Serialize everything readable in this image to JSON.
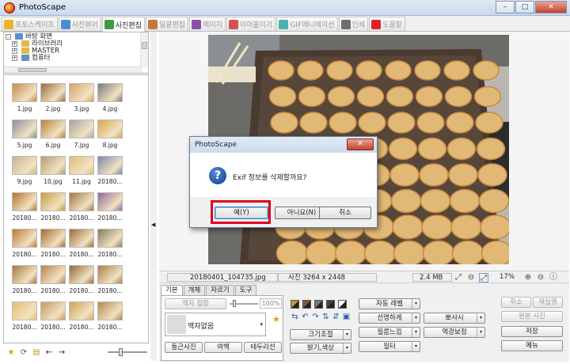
{
  "window": {
    "title": "PhotoScape",
    "minimize": "–",
    "maximize": "□",
    "close": "✕"
  },
  "tabs": [
    {
      "label": "포토스케이프",
      "color": "#e9b52d",
      "active": false
    },
    {
      "label": "사진뷰어",
      "color": "#4a8ed6",
      "active": false
    },
    {
      "label": "사진편집",
      "color": "#3b9a43",
      "active": true
    },
    {
      "label": "일괄편집",
      "color": "#c2783c",
      "active": false
    },
    {
      "label": "페이지",
      "color": "#8b4fa8",
      "active": false
    },
    {
      "label": "이어붙이기",
      "color": "#d94f4f",
      "active": false
    },
    {
      "label": "GIF애니메이션",
      "color": "#4ab0b0",
      "active": false
    },
    {
      "label": "인쇄",
      "color": "#6f6f6f",
      "active": false
    },
    {
      "label": "도움말",
      "color": "#d22",
      "active": false
    }
  ],
  "tree": [
    {
      "label": "바탕 화면",
      "exp": "-",
      "color": "#5a8fd0"
    },
    {
      "label": "라이브러리",
      "exp": "+",
      "color": "#e0b94a"
    },
    {
      "label": "MASTER",
      "exp": "+",
      "color": "#e0b94a"
    },
    {
      "label": "컴퓨터",
      "exp": "+",
      "color": "#6c8fb8"
    }
  ],
  "thumbnails": [
    {
      "label": "1.jpg",
      "color": "#c68a4a"
    },
    {
      "label": "2.jpg",
      "color": "#9a6a3a"
    },
    {
      "label": "3.jpg",
      "color": "#d6a56a"
    },
    {
      "label": "4.jpg",
      "color": "#7a7a7a"
    },
    {
      "label": "5.jpg",
      "color": "#8a8f98"
    },
    {
      "label": "6.jpg",
      "color": "#b7823a"
    },
    {
      "label": "7.jpg",
      "color": "#a8a49a"
    },
    {
      "label": "8.jpg",
      "color": "#d9a74e"
    },
    {
      "label": "9.jpg",
      "color": "#c9b490"
    },
    {
      "label": "10.jpg",
      "color": "#b79a6a"
    },
    {
      "label": "11.jpg",
      "color": "#e0c078"
    },
    {
      "label": "20180...",
      "color": "#7a86b0"
    },
    {
      "label": "20180...",
      "color": "#b5732e"
    },
    {
      "label": "20180...",
      "color": "#c99a40"
    },
    {
      "label": "20180...",
      "color": "#a07848"
    },
    {
      "label": "20180...",
      "color": "#8d6a9a"
    },
    {
      "label": "20180...",
      "color": "#b87a34"
    },
    {
      "label": "20180...",
      "color": "#a36a30"
    },
    {
      "label": "20180...",
      "color": "#9c6c34"
    },
    {
      "label": "20180...",
      "color": "#8a7a5a"
    },
    {
      "label": "20180...",
      "color": "#a9783a"
    },
    {
      "label": "20180...",
      "color": "#b3854a"
    },
    {
      "label": "20180...",
      "color": "#94683a"
    },
    {
      "label": "20180...",
      "color": "#a88040"
    },
    {
      "label": "20180...",
      "color": "#e3c070"
    },
    {
      "label": "20180...",
      "color": "#c99a60"
    },
    {
      "label": "20180...",
      "color": "#d3a35a"
    },
    {
      "label": "20180...",
      "color": "#b58850"
    }
  ],
  "left_toolbar": {
    "star": "★",
    "refresh": "⟳",
    "folder": "▤",
    "back": "←",
    "forward": "→"
  },
  "splitter_arrow": "◀",
  "status": {
    "filename": "20180401_104735.jpg",
    "dimensions": "사진 3264 x 2448",
    "filesize": "2.4 MB",
    "zoom": "17%"
  },
  "status_icons": {
    "fit": "⤢",
    "zoom_out_fit": "⊖",
    "zoom_in": "⊕",
    "zoom_out": "⊖",
    "info": "ⓘ"
  },
  "edit_tabs": [
    {
      "label": "기본",
      "active": true
    },
    {
      "label": "개체",
      "active": false
    },
    {
      "label": "자르기",
      "active": false
    },
    {
      "label": "도구",
      "active": false
    }
  ],
  "edit": {
    "frame_merge": "액자 접합",
    "percent": "100%",
    "frame_none": "액자없음",
    "star": "★",
    "round_photo": "둥근사진",
    "margin": "여백",
    "filmstrip": "테두리선",
    "auto_level": "자동 레벨",
    "sharpen": "선명하게",
    "bloom": "뽀사시",
    "resize": "크기조절",
    "film_effect": "필름느낌",
    "backlight": "역광보정",
    "brightness": "밝기,색상",
    "filter": "필터",
    "undo": "취소",
    "redo": "재실행",
    "original": "원본 사진",
    "save": "저장",
    "menu": "메뉴",
    "dropdown_arrow": "▾",
    "rotate_icons": [
      "⇆",
      "↶",
      "↷",
      "⇅",
      "⇵",
      "▣"
    ]
  },
  "swatches": [
    "#c8963e",
    "#7a5a3a",
    "#777777",
    "#444444",
    "#ffffff"
  ],
  "dialog": {
    "title": "PhotoScape",
    "close": "✕",
    "message": "Exif 정보를 삭제할까요?",
    "icon": "?",
    "yes": "예(Y)",
    "no": "아니요(N)",
    "cancel": "취소"
  },
  "colors": {
    "highlight": "#e0001b",
    "tray": "#5b4a3b",
    "cookie": "#e2b877"
  }
}
